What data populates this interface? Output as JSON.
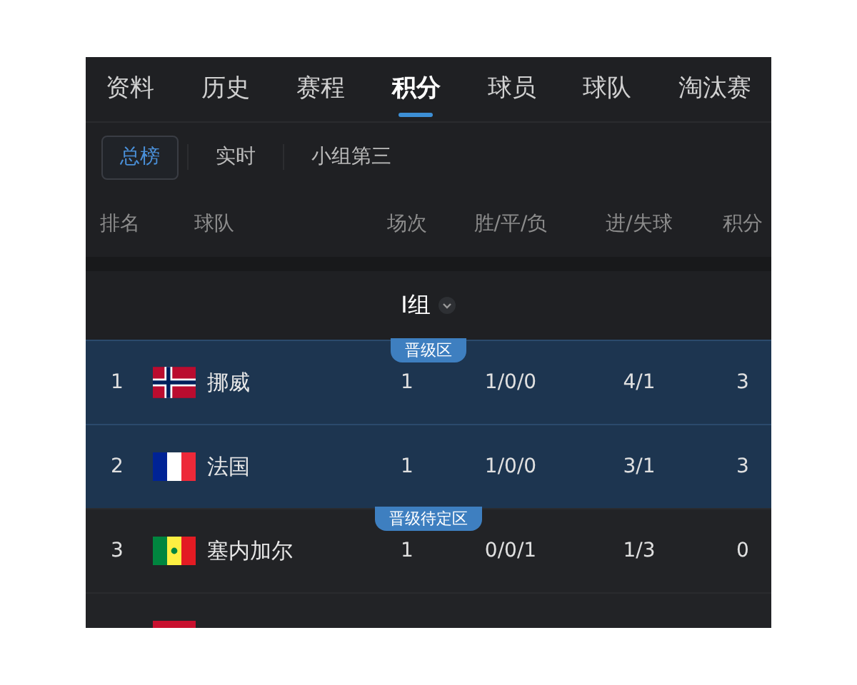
{
  "tabs": [
    {
      "label": "资料",
      "selected": false
    },
    {
      "label": "历史",
      "selected": false
    },
    {
      "label": "赛程",
      "selected": false
    },
    {
      "label": "积分",
      "selected": true
    },
    {
      "label": "球员",
      "selected": false
    },
    {
      "label": "球队",
      "selected": false
    },
    {
      "label": "淘汰赛",
      "selected": false
    }
  ],
  "sub_tabs": [
    {
      "label": "总榜",
      "selected": true
    },
    {
      "label": "实时",
      "selected": false
    },
    {
      "label": "小组第三",
      "selected": false
    }
  ],
  "table": {
    "columns": [
      "排名",
      "球队",
      "场次",
      "胜/平/负",
      "进/失球",
      "积分"
    ],
    "group": "I组",
    "rows": [
      {
        "zone_label": "晋级区",
        "highlighted": true,
        "flag": {
          "kind": "norway"
        },
        "cells": [
          "1",
          "挪威",
          "1",
          "1/0/0",
          "4/1",
          "3"
        ]
      },
      {
        "highlighted": true,
        "flag": {
          "kind": "france"
        },
        "cells": [
          "2",
          "法国",
          "1",
          "1/0/0",
          "3/1",
          "3"
        ]
      },
      {
        "zone_label": "晋级待定区",
        "highlighted": false,
        "flag": {
          "kind": "senegal"
        },
        "cells": [
          "3",
          "塞内加尔",
          "1",
          "0/0/1",
          "1/3",
          "0"
        ]
      },
      {
        "highlighted": false,
        "flag": {
          "kind": "red"
        },
        "cells": []
      }
    ]
  }
}
